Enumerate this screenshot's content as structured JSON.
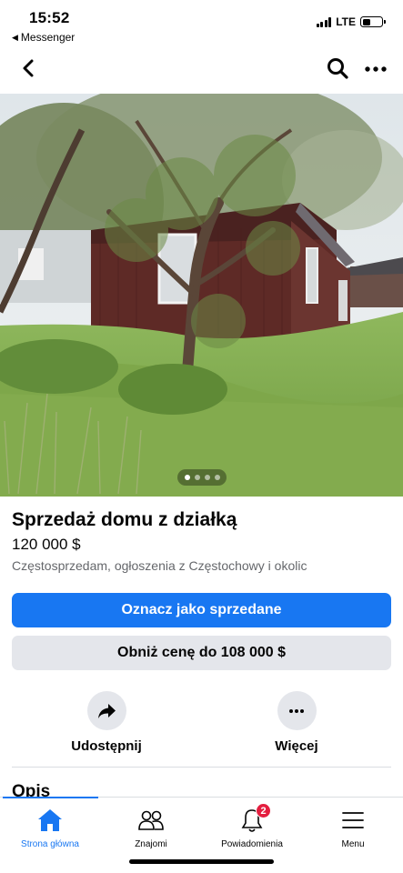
{
  "status_bar": {
    "time": "15:52",
    "back_app": "Messenger",
    "network": "LTE",
    "battery_level": 0.4
  },
  "nav": {
    "back_icon": "chevron-left-icon",
    "search_icon": "search-icon",
    "more_icon": "more-horizontal-icon"
  },
  "listing": {
    "photo_count": 4,
    "active_photo_index": 0,
    "title": "Sprzedaż domu z działką",
    "price": "120 000 $",
    "seller": "Częstosprzedam, ogłoszenia z Częstochowy i okolic"
  },
  "buttons": {
    "mark_sold": "Oznacz jako sprzedane",
    "lower_price": "Obniż cenę do 108 000 $"
  },
  "actions": {
    "share_label": "Udostępnij",
    "more_label": "Więcej"
  },
  "section": {
    "title": "Opis"
  },
  "tabs": [
    {
      "label": "Strona główna",
      "icon": "home-icon",
      "active": true
    },
    {
      "label": "Znajomi",
      "icon": "friends-icon",
      "active": false
    },
    {
      "label": "Powiadomienia",
      "icon": "bell-icon",
      "active": false,
      "badge": "2"
    },
    {
      "label": "Menu",
      "icon": "menu-icon",
      "active": false
    }
  ],
  "colors": {
    "accent": "#1877f2",
    "secondary_button": "#e4e6eb",
    "badge": "#e41e3f",
    "muted_text": "#65676b"
  }
}
